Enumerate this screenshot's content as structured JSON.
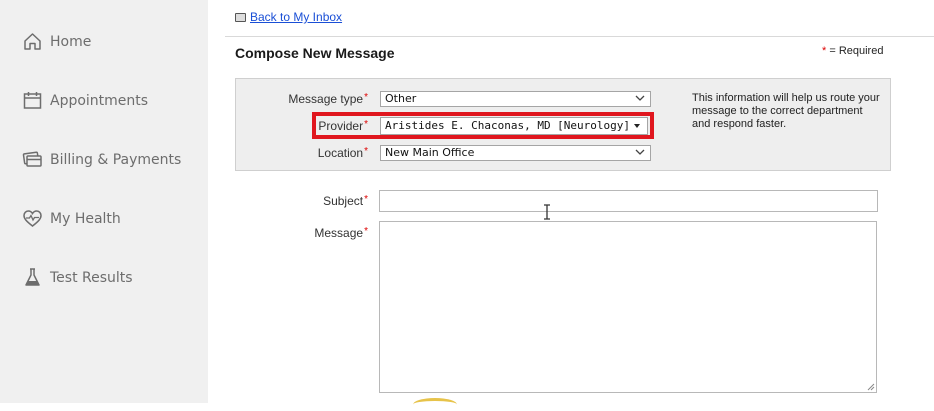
{
  "sidebar": {
    "items": [
      {
        "label": "Home",
        "icon": "home-icon"
      },
      {
        "label": "Appointments",
        "icon": "calendar-icon"
      },
      {
        "label": "Billing & Payments",
        "icon": "billing-icon"
      },
      {
        "label": "My Health",
        "icon": "heart-pulse-icon"
      },
      {
        "label": "Test Results",
        "icon": "flask-icon"
      }
    ]
  },
  "header": {
    "back_link": "Back to My Inbox",
    "title": "Compose New Message",
    "required_mark": "*",
    "required_note": " = Required"
  },
  "form": {
    "message_type": {
      "label": "Message type",
      "value": "Other"
    },
    "provider": {
      "label": "Provider",
      "value": "Aristides E. Chaconas, MD [Neurology]"
    },
    "location": {
      "label": "Location",
      "value": "New Main Office"
    },
    "info_text": "This information will help us route your message to the correct department and respond faster.",
    "subject": {
      "label": "Subject",
      "value": ""
    },
    "message": {
      "label": "Message",
      "value": ""
    }
  },
  "colors": {
    "highlight": "#e0161e",
    "link": "#1a4fd6",
    "required": "#dd0000",
    "sidebar_bg": "#f0f0f0"
  }
}
